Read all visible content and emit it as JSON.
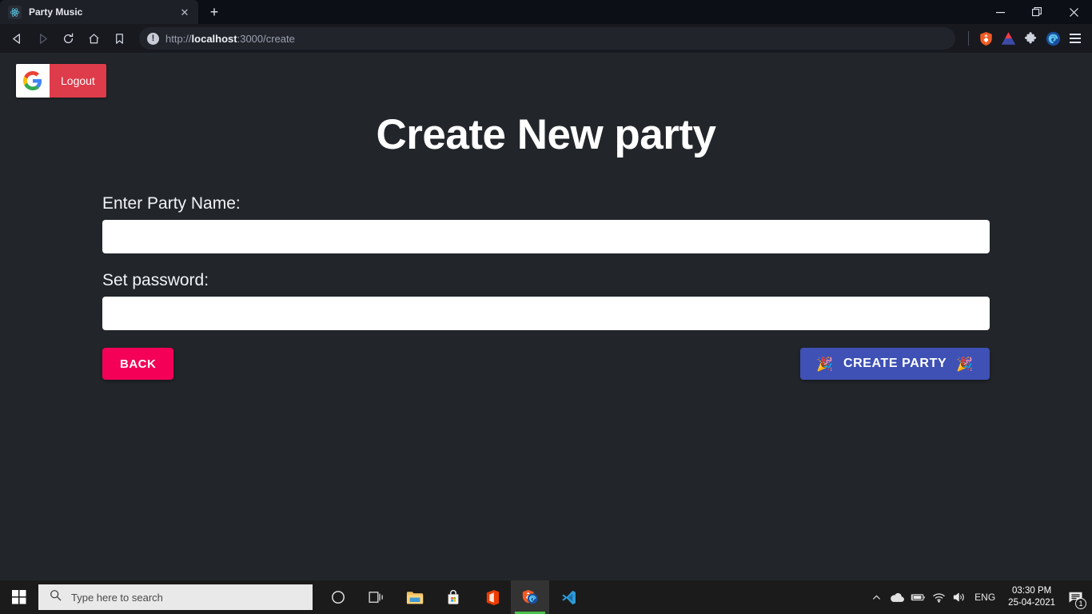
{
  "browser": {
    "tab": {
      "title": "Party Music",
      "favicon": "react-logo-icon",
      "close_label": "✕"
    },
    "new_tab_label": "+",
    "window_controls": {
      "minimize": "—",
      "restore": "❐",
      "close": "✕"
    },
    "nav": {
      "back": "back-arrow-icon",
      "forward": "forward-arrow-icon",
      "reload": "reload-icon",
      "home": "home-icon",
      "bookmark": "bookmark-icon"
    },
    "omnibox": {
      "info_glyph": "!",
      "url_scheme": "http://",
      "url_host": "localhost",
      "url_rest": ":3000/create",
      "url_full": "http://localhost:3000/create"
    },
    "toolbar_icons": [
      "brave-shield-icon",
      "brave-rewards-triangle-icon",
      "extensions-puzzle-icon",
      "profile-avatar-icon",
      "browser-menu-icon"
    ]
  },
  "page": {
    "background_color": "#22262b",
    "logout": {
      "label": "Logout",
      "icon": "google-g-icon",
      "color": "#de3b4b"
    },
    "title": "Create New party",
    "fields": [
      {
        "label": "Enter Party Name:",
        "value": "",
        "placeholder": "",
        "type": "text"
      },
      {
        "label": "Set password:",
        "value": "",
        "placeholder": "",
        "type": "text"
      }
    ],
    "buttons": {
      "back": {
        "label": "BACK",
        "color": "#f50057"
      },
      "create": {
        "label": "CREATE PARTY",
        "color": "#3f51b5",
        "emoji_left": "🎉",
        "emoji_right": "🎉"
      }
    }
  },
  "taskbar": {
    "start": "windows-start-icon",
    "search_placeholder": "Type here to search",
    "apps": [
      "cortana-icon",
      "task-view-icon",
      "file-explorer-icon",
      "microsoft-store-icon",
      "office-icon",
      "brave-browser-icon",
      "vs-code-icon"
    ],
    "tray": {
      "chevron": "︿",
      "icons": [
        "onedrive-cloud-icon",
        "battery-icon",
        "wifi-icon",
        "volume-icon"
      ],
      "language": "ENG",
      "time": "03:30 PM",
      "date": "25-04-2021",
      "notification_count": "1"
    }
  }
}
